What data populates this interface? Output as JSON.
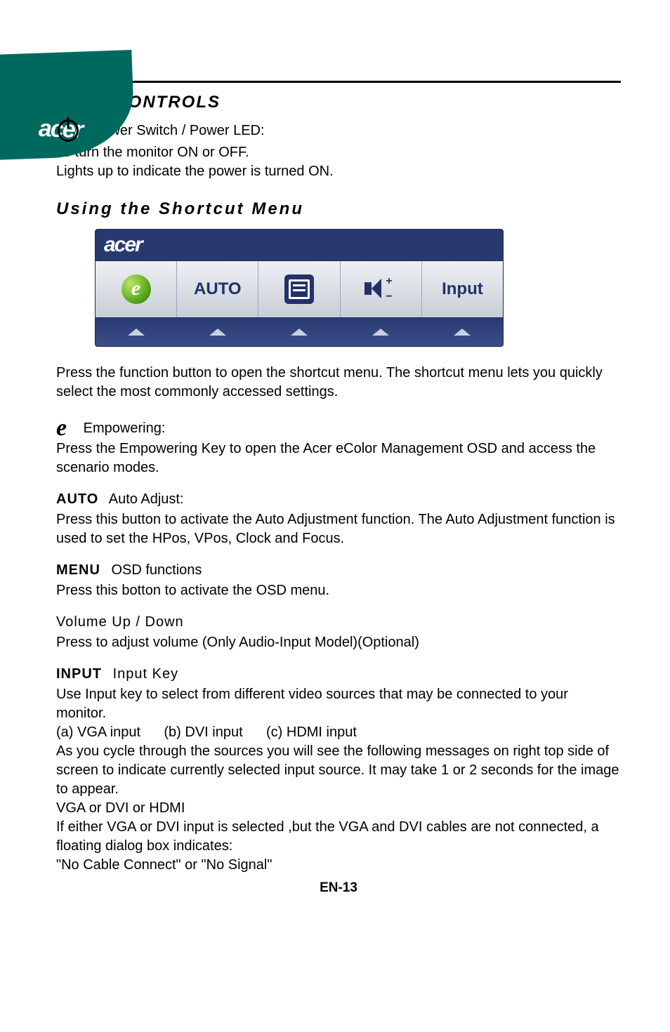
{
  "brand": "acer",
  "headings": {
    "user_controls": "USER CONTROLS",
    "shortcut_menu": "Using  the Shortcut Menu"
  },
  "power": {
    "heading": "Power Switch / Power LED:",
    "line1": "To turn the monitor ON or OFF.",
    "line2": "Lights up to indicate the power is turned ON."
  },
  "osd": {
    "logo": "acer",
    "auto": "AUTO",
    "input": "Input"
  },
  "shortcut_intro": "Press the function button to open the shortcut menu. The shortcut menu lets you quickly select the most commonly accessed settings.",
  "empowering": {
    "e": "e",
    "label": "Empowering:",
    "desc": "Press the Empowering Key to open the Acer eColor Management OSD and access the scenario modes."
  },
  "auto_adjust": {
    "badge": "AUTO",
    "label": "Auto Adjust:",
    "desc": "Press this button to activate the Auto Adjustment function. The Auto Adjustment function is used to set the HPos, VPos, Clock and Focus."
  },
  "menu": {
    "badge": "MENU",
    "label": "OSD functions",
    "desc": "Press this botton to activate the OSD menu."
  },
  "volume": {
    "heading": "Volume Up / Down",
    "desc": " Press to adjust volume (Only Audio-Input Model)(Optional)"
  },
  "input_key": {
    "badge": "INPUT",
    "label": "Input Key",
    "para1": "Use Input key to select from different video sources that may be connected to your monitor.",
    "options": "(a) VGA input      (b) DVI input      (c) HDMI input",
    "para2": "As you cycle through the sources you will see the following messages on right top side of screen to indicate currently selected input source. It may take 1 or 2 seconds for the image to appear.",
    "line3": "VGA  or  DVI  or  HDMI",
    "line4": "If either VGA or DVI input is selected ,but the VGA and DVI cables are not connected, a floating dialog box indicates:",
    "line5": "\"No Cable Connect\" or \"No Signal\""
  },
  "footer": "EN-13"
}
